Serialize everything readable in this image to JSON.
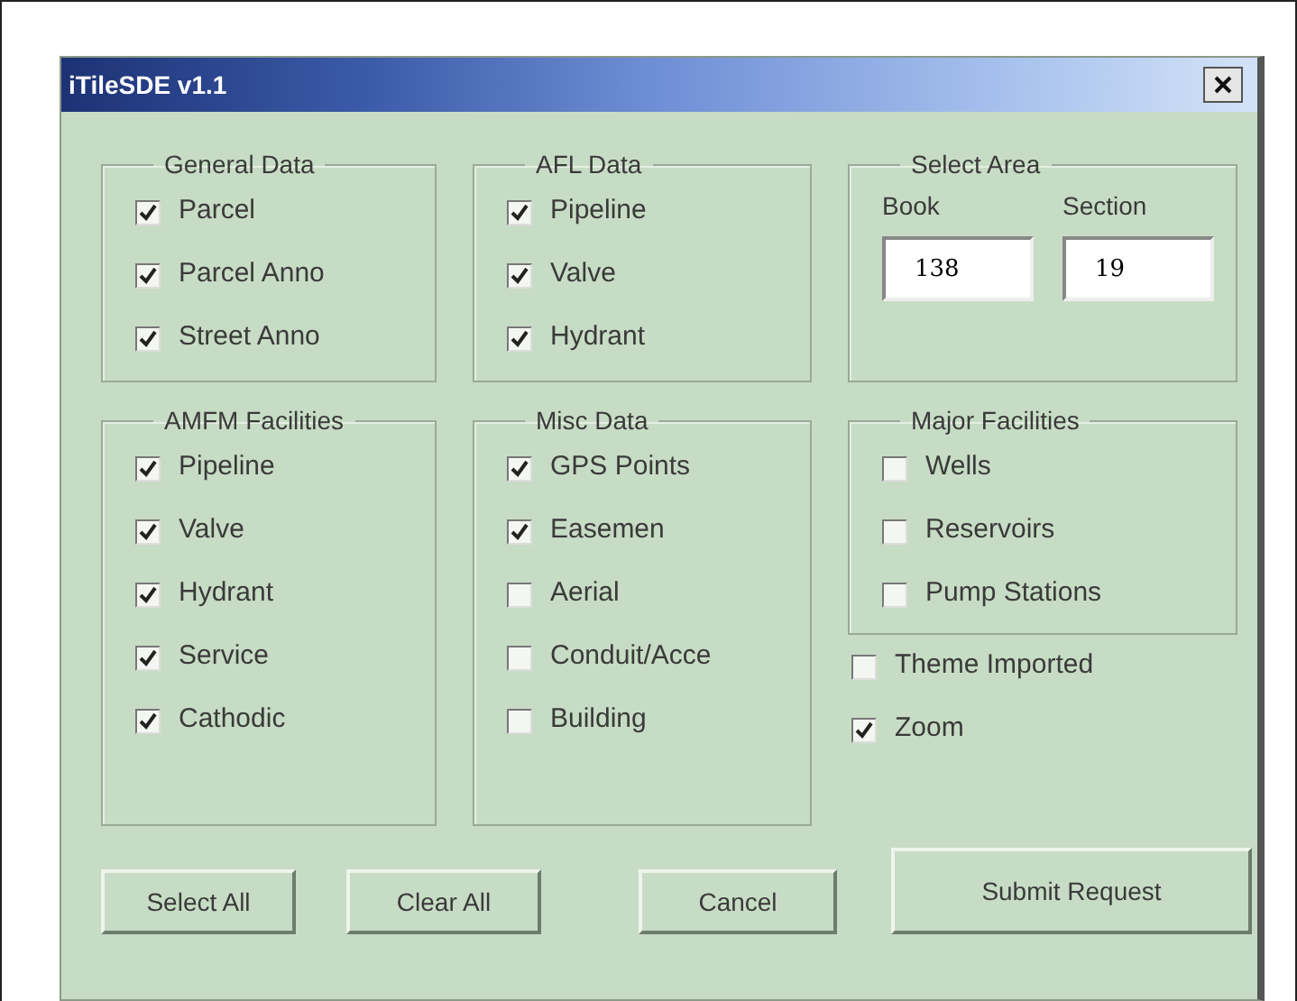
{
  "window": {
    "title": "iTileSDE v1.1"
  },
  "groups": [
    {
      "kind": "checklist",
      "legend": "General Data",
      "items": [
        {
          "label": "Parcel",
          "checked": true
        },
        {
          "label": "Parcel Anno",
          "checked": true
        },
        {
          "label": "Street Anno",
          "checked": true
        }
      ]
    },
    {
      "kind": "checklist",
      "legend": "AFL Data",
      "items": [
        {
          "label": "Pipeline",
          "checked": true
        },
        {
          "label": "Valve",
          "checked": true
        },
        {
          "label": "Hydrant",
          "checked": true
        }
      ]
    },
    {
      "kind": "fields",
      "legend": "Select Area",
      "fields": [
        {
          "label": "Book",
          "value": "138"
        },
        {
          "label": "Section",
          "value": "19"
        }
      ]
    },
    {
      "kind": "checklist",
      "legend": "AMFM Facilities",
      "items": [
        {
          "label": "Pipeline",
          "checked": true
        },
        {
          "label": "Valve",
          "checked": true
        },
        {
          "label": "Hydrant",
          "checked": true
        },
        {
          "label": "Service",
          "checked": true
        },
        {
          "label": "Cathodic",
          "checked": true
        }
      ]
    },
    {
      "kind": "checklist",
      "legend": "Misc Data",
      "items": [
        {
          "label": "GPS Points",
          "checked": true
        },
        {
          "label": "Easemen",
          "checked": true
        },
        {
          "label": "Aerial",
          "checked": false
        },
        {
          "label": "Conduit/Acce",
          "checked": false
        },
        {
          "label": "Building",
          "checked": false
        }
      ]
    },
    {
      "kind": "checklist",
      "legend": "Major Facilities",
      "items": [
        {
          "label": "Wells",
          "checked": false
        },
        {
          "label": "Reservoirs",
          "checked": false
        },
        {
          "label": "Pump Stations",
          "checked": false
        }
      ]
    }
  ],
  "options": [
    {
      "label": "Theme Imported",
      "checked": false
    },
    {
      "label": "Zoom",
      "checked": true
    }
  ],
  "buttons": [
    {
      "label": "Select All"
    },
    {
      "label": "Clear All"
    },
    {
      "label": "Cancel"
    },
    {
      "label": "Submit Request"
    }
  ]
}
